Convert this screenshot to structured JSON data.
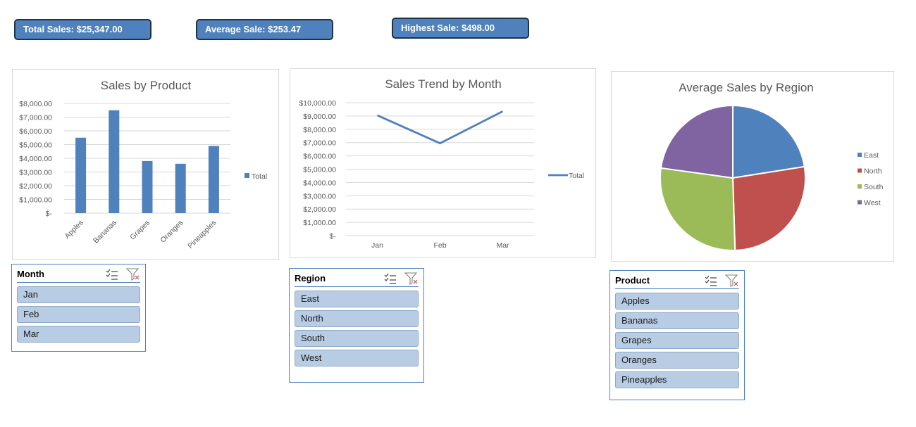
{
  "kpis": {
    "total": "Total Sales: $25,347.00",
    "average": "Average Sale: $253.47",
    "highest": "Highest Sale: $498.00"
  },
  "colors": {
    "accent": "#4f81bd",
    "east": "#4f81bd",
    "north": "#c0504d",
    "south": "#9bbb59",
    "west": "#8064a2"
  },
  "chart_data": [
    {
      "type": "bar",
      "title": "Sales by Product",
      "categories": [
        "Apples",
        "Bananas",
        "Grapes",
        "Oranges",
        "Pineapples"
      ],
      "series": [
        {
          "name": "Total",
          "values": [
            5500,
            7500,
            3800,
            3600,
            4900
          ]
        }
      ],
      "ylim": [
        0,
        8000
      ],
      "yticks": [
        "$-",
        "$1,000.00",
        "$2,000.00",
        "$3,000.00",
        "$4,000.00",
        "$5,000.00",
        "$6,000.00",
        "$7,000.00",
        "$8,000.00"
      ],
      "legend": "right",
      "grid": true
    },
    {
      "type": "line",
      "title": "Sales Trend by Month",
      "categories": [
        "Jan",
        "Feb",
        "Mar"
      ],
      "series": [
        {
          "name": "Total",
          "values": [
            9050,
            6950,
            9350
          ]
        }
      ],
      "ylim": [
        0,
        10000
      ],
      "yticks": [
        "$-",
        "$1,000.00",
        "$2,000.00",
        "$3,000.00",
        "$4,000.00",
        "$5,000.00",
        "$6,000.00",
        "$7,000.00",
        "$8,000.00",
        "$9,000.00",
        "$10,000.00"
      ],
      "legend": "right",
      "grid": true
    },
    {
      "type": "pie",
      "title": "Average Sales by Region",
      "categories": [
        "East",
        "North",
        "South",
        "West"
      ],
      "values": [
        22.5,
        27,
        27.7,
        22.8
      ],
      "legend": "right"
    }
  ],
  "slicers": {
    "month": {
      "title": "Month",
      "items": [
        "Jan",
        "Feb",
        "Mar"
      ]
    },
    "region": {
      "title": "Region",
      "items": [
        "East",
        "North",
        "South",
        "West"
      ]
    },
    "product": {
      "title": "Product",
      "items": [
        "Apples",
        "Bananas",
        "Grapes",
        "Oranges",
        "Pineapples"
      ]
    }
  }
}
